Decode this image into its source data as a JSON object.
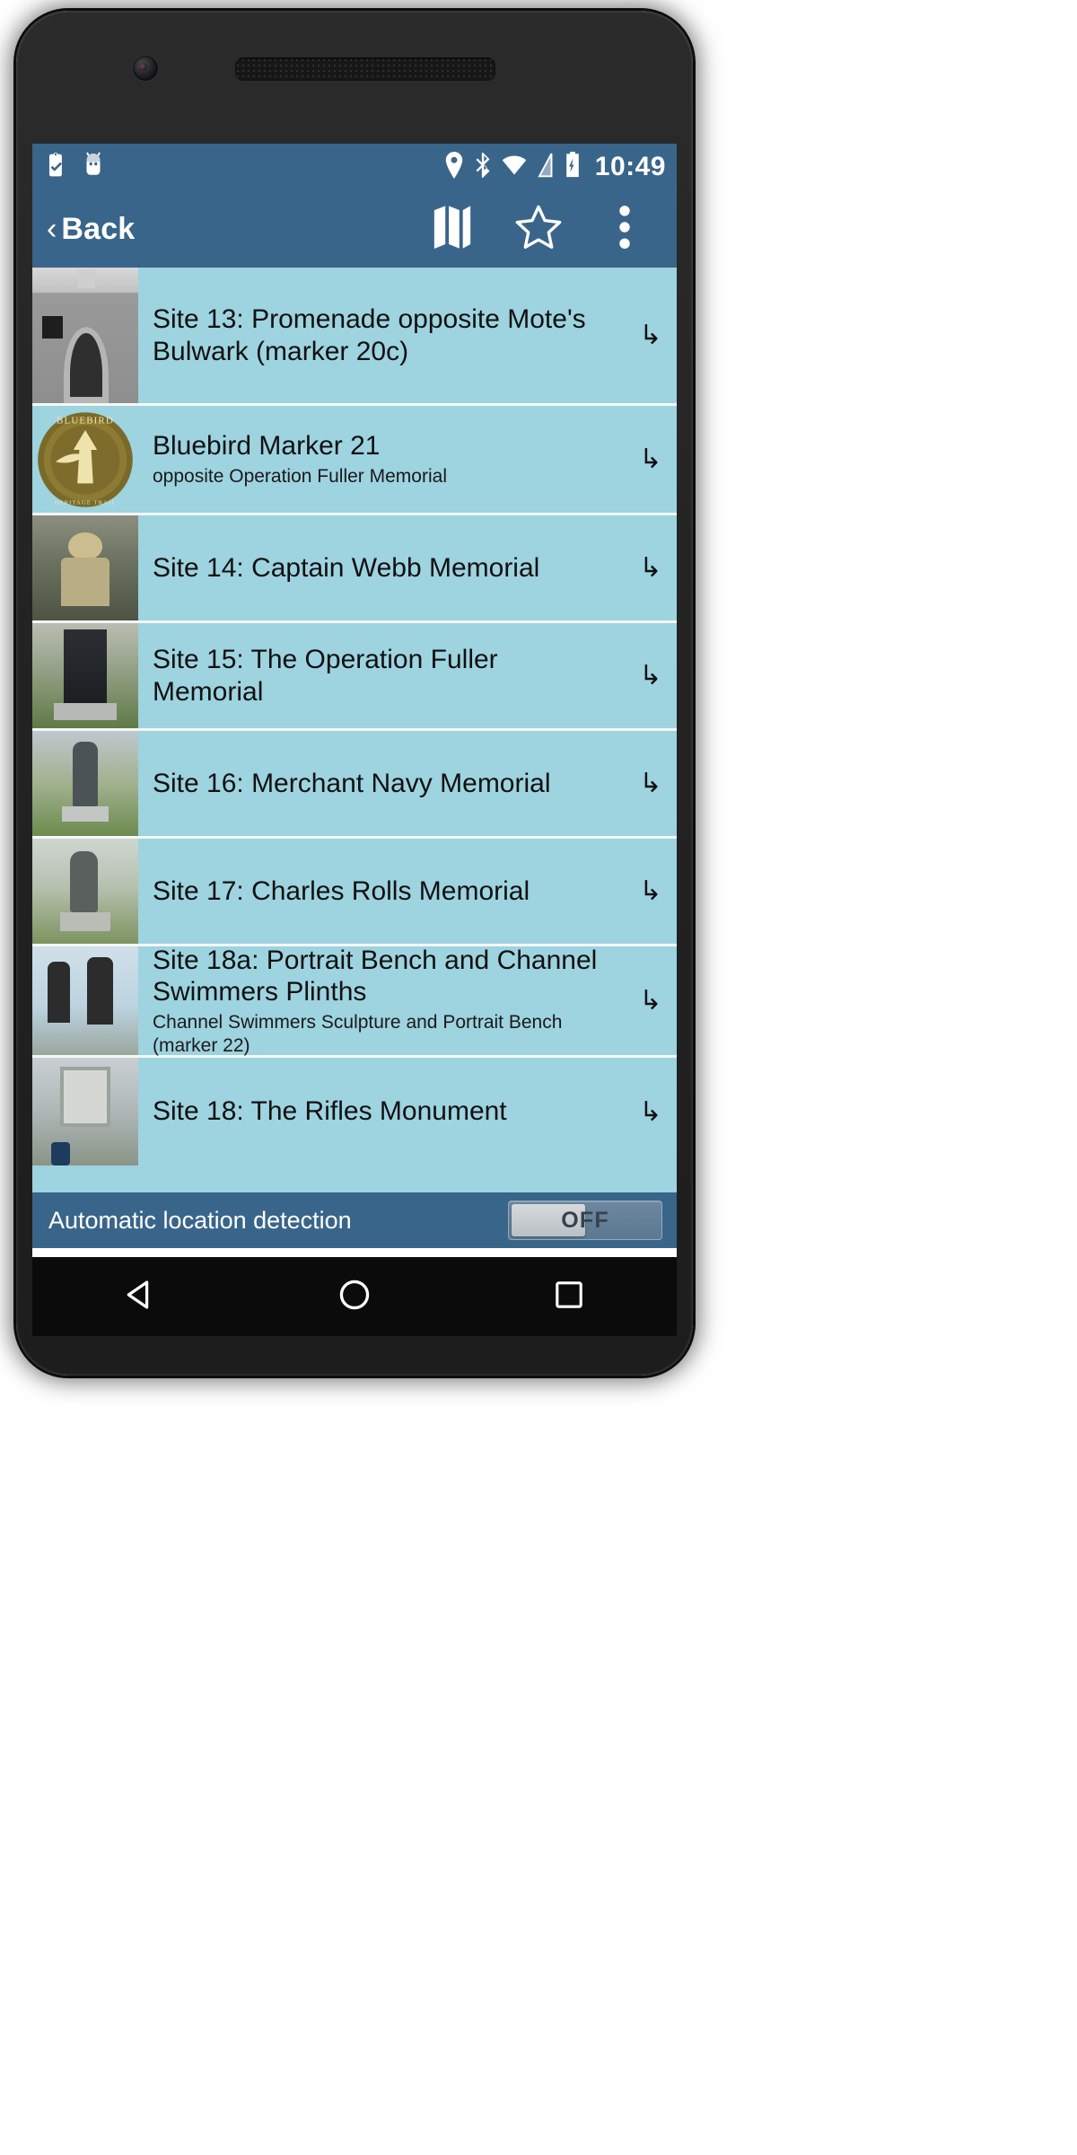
{
  "status_bar": {
    "time": "10:49",
    "left_icons": [
      "clipboard-check-icon",
      "android-head-icon"
    ],
    "right_icons": [
      "location-pin-icon",
      "bluetooth-icon",
      "wifi-icon",
      "signal-icon",
      "battery-charging-icon"
    ],
    "background_color": "#3a658a"
  },
  "action_bar": {
    "back_chevron": "‹",
    "back_label": "Back",
    "icons": [
      {
        "name": "map-icon",
        "label": "Map"
      },
      {
        "name": "star-icon",
        "label": "Favourites"
      },
      {
        "name": "overflow-menu-icon",
        "label": "More options"
      }
    ],
    "background_color": "#3a658a"
  },
  "list": {
    "row_background": "#9ed3e0",
    "arrow_glyph": "↳",
    "items": [
      {
        "title": "Site 13: Promenade opposite Mote's Bulwark (marker 20c)",
        "subtitle": "",
        "thumb": "stone-arch-photo",
        "thumb_class": "t-arch"
      },
      {
        "title": "Bluebird Marker 21",
        "subtitle": "opposite Operation Fuller Memorial",
        "thumb": "bluebird-heritage-trail-medallion",
        "thumb_class": "t-medal"
      },
      {
        "title": "Site 14: Captain Webb Memorial",
        "subtitle": "",
        "thumb": "captain-webb-bust-photo",
        "thumb_class": "t-bust"
      },
      {
        "title": "Site 15: The Operation Fuller Memorial",
        "subtitle": "",
        "thumb": "operation-fuller-memorial-photo",
        "thumb_class": "t-obelisk"
      },
      {
        "title": "Site 16: Merchant Navy Memorial",
        "subtitle": "",
        "thumb": "merchant-navy-memorial-statue-photo",
        "thumb_class": "t-statue"
      },
      {
        "title": "Site 17: Charles Rolls Memorial",
        "subtitle": "",
        "thumb": "charles-rolls-memorial-statue-photo",
        "thumb_class": "t-statue2"
      },
      {
        "title": "Site 18a: Portrait Bench and Channel Swimmers Plinths",
        "subtitle": "Channel Swimmers Sculpture and Portrait Bench (marker 22)",
        "thumb": "portrait-bench-photo",
        "thumb_class": "t-bench"
      },
      {
        "title": "Site 18: The Rifles Monument",
        "subtitle": "",
        "thumb": "rifles-monument-photo",
        "thumb_class": "t-monument"
      }
    ]
  },
  "location_bar": {
    "label": "Automatic location detection",
    "toggle_state": "OFF",
    "background_color": "#3a658a"
  },
  "nav_bar": {
    "buttons": [
      {
        "name": "back-triangle-icon",
        "label": "Back"
      },
      {
        "name": "home-circle-icon",
        "label": "Home"
      },
      {
        "name": "recents-square-icon",
        "label": "Recents"
      }
    ]
  },
  "medallion": {
    "top_text": "BLUEBIRD",
    "bottom_text": "HERITAGE TRAIL"
  }
}
